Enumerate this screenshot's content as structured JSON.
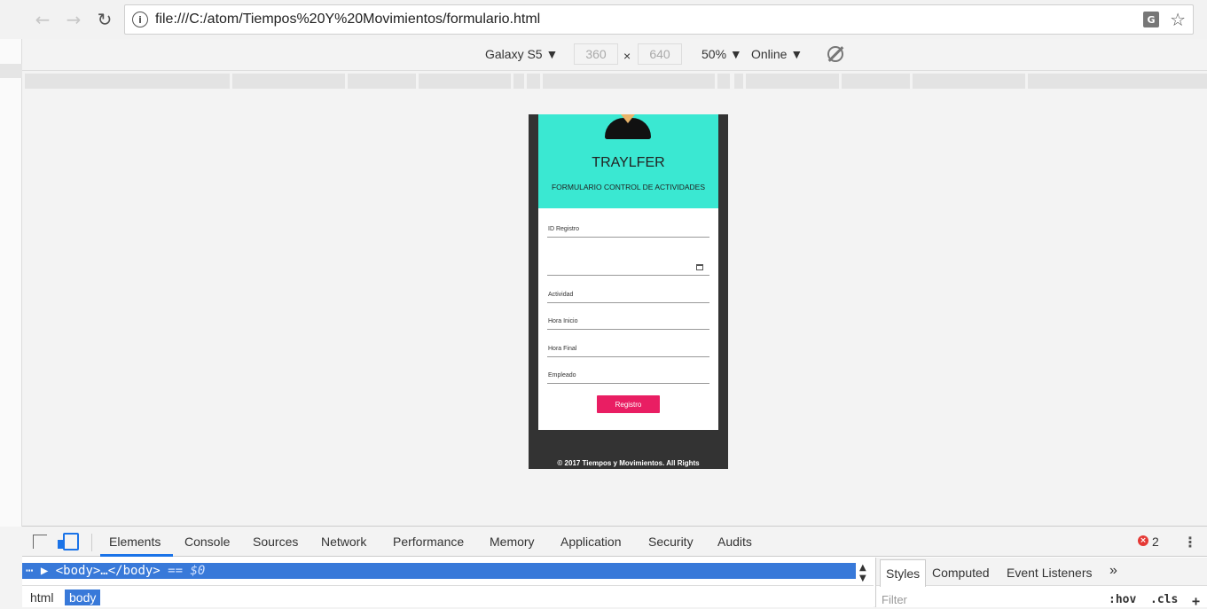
{
  "browser": {
    "url": "file:///C:/atom/Tiempos%20Y%20Movimientos/formulario.html",
    "info_icon": "i"
  },
  "device_toolbar": {
    "device": "Galaxy S5 ▼",
    "width": "360",
    "times": "×",
    "height": "640",
    "zoom": "50% ▼",
    "network": "Online ▼"
  },
  "page": {
    "brand": "TRAYLFER",
    "subtitle": "FORMULARIO CONTROL DE ACTIVIDADES",
    "fields": [
      "ID Registro",
      "",
      "Actividad",
      "Hora Inicio",
      "Hora Final",
      "Empleado"
    ],
    "submit_label": "Registro",
    "footer": "© 2017 Tiempos y Movimientos. All Rights"
  },
  "devtools": {
    "tabs": [
      "Elements",
      "Console",
      "Sources",
      "Network",
      "Performance",
      "Memory",
      "Application",
      "Security",
      "Audits"
    ],
    "error_count": "2",
    "selected_row": "▶ <body>…</body>",
    "selected_suffix": " == $0",
    "breadcrumbs": [
      "html",
      "body"
    ],
    "styles_tabs": [
      "Styles",
      "Computed",
      "Event Listeners",
      "»"
    ],
    "filter_placeholder": "Filter",
    "hov": ":hov",
    "cls": ".cls",
    "plus": "+"
  },
  "colors": {
    "header_bg": "#3ae8d2",
    "button_bg": "#e91e63",
    "device_frame": "#333333",
    "devtools_selection": "#3879d9"
  }
}
